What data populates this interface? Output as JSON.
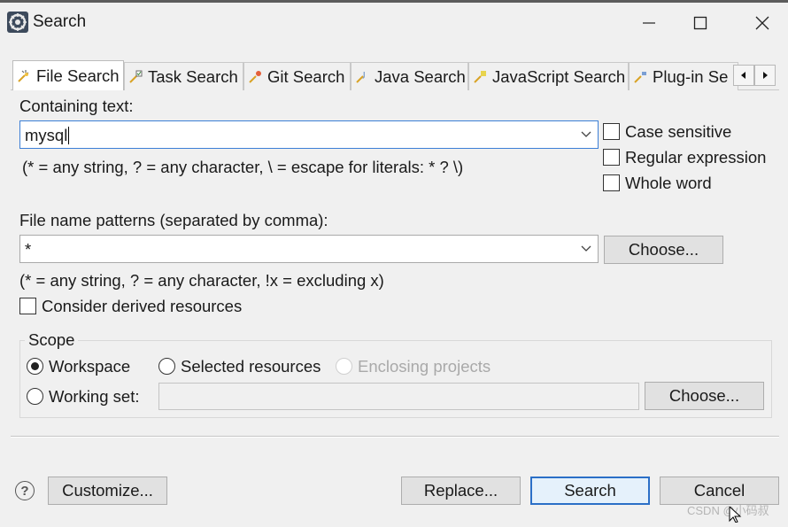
{
  "window": {
    "title": "Search"
  },
  "tabs": [
    {
      "label": "File Search",
      "icon": "file-search-icon",
      "active": true
    },
    {
      "label": "Task Search",
      "icon": "task-search-icon"
    },
    {
      "label": "Git Search",
      "icon": "git-search-icon"
    },
    {
      "label": "Java Search",
      "icon": "java-search-icon"
    },
    {
      "label": "JavaScript Search",
      "icon": "javascript-search-icon"
    },
    {
      "label": "Plug-in Se",
      "icon": "plugin-search-icon"
    }
  ],
  "containing": {
    "label": "Containing text:",
    "value": "mysql",
    "hint": "(* = any string, ? = any character, \\ = escape for literals: * ? \\)"
  },
  "options": {
    "case_sensitive": "Case sensitive",
    "regular_expression": "Regular expression",
    "whole_word": "Whole word"
  },
  "file_patterns": {
    "label": "File name patterns (separated by comma):",
    "value": "*",
    "hint": "(* = any string, ? = any character, !x = excluding x)",
    "choose_label": "Choose...",
    "derived_label": "Consider derived resources"
  },
  "scope": {
    "title": "Scope",
    "workspace": "Workspace",
    "selected_resources": "Selected resources",
    "enclosing_projects": "Enclosing projects",
    "working_set": "Working set:",
    "working_set_value": "",
    "choose_label": "Choose..."
  },
  "footer": {
    "customize_label": "Customize...",
    "replace_label": "Replace...",
    "search_label": "Search",
    "cancel_label": "Cancel"
  },
  "watermark": "CSDN @小码叔",
  "colors": {
    "focus_border": "#3c7fd6",
    "default_button_border": "#2b6fc7"
  }
}
